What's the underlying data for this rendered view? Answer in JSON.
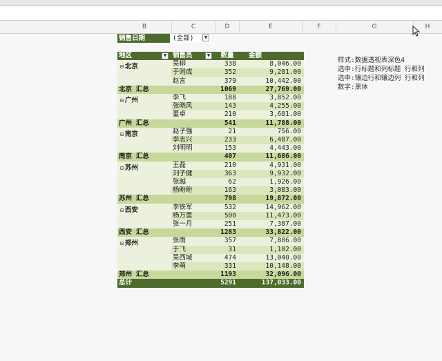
{
  "columns": [
    "B",
    "C",
    "D",
    "E",
    "F",
    "G",
    "H"
  ],
  "filter": {
    "label": "销售日期",
    "value": "(全部)"
  },
  "table": {
    "headers": {
      "region": "地区",
      "salesperson": "销售员",
      "qty": "数量",
      "amount": "金额"
    },
    "groups": [
      {
        "region": "北京",
        "rows": [
          {
            "name": "吴柳",
            "qty": "338",
            "amount": "8,046.00"
          },
          {
            "name": "于则成",
            "qty": "352",
            "amount": "9,281.00"
          },
          {
            "name": "赵言",
            "qty": "379",
            "amount": "10,442.00"
          }
        ],
        "subtotal": {
          "label": "北京 汇总",
          "qty": "1069",
          "amount": "27,769.00"
        }
      },
      {
        "region": "广州",
        "rows": [
          {
            "name": "李飞",
            "qty": "188",
            "amount": "3,852.00"
          },
          {
            "name": "张晓风",
            "qty": "143",
            "amount": "4,255.00"
          },
          {
            "name": "董卓",
            "qty": "210",
            "amount": "3,681.00"
          }
        ],
        "subtotal": {
          "label": "广州 汇总",
          "qty": "541",
          "amount": "11,788.00"
        }
      },
      {
        "region": "南京",
        "rows": [
          {
            "name": "赵子强",
            "qty": "21",
            "amount": "756.00"
          },
          {
            "name": "李志兴",
            "qty": "233",
            "amount": "6,487.00"
          },
          {
            "name": "刘明明",
            "qty": "153",
            "amount": "4,443.00"
          }
        ],
        "subtotal": {
          "label": "南京 汇总",
          "qty": "407",
          "amount": "11,686.00"
        }
      },
      {
        "region": "苏州",
        "rows": [
          {
            "name": "王磊",
            "qty": "210",
            "amount": "4,931.00"
          },
          {
            "name": "刘子健",
            "qty": "363",
            "amount": "9,932.00"
          },
          {
            "name": "张越",
            "qty": "62",
            "amount": "1,926.00"
          },
          {
            "name": "杨盼盼",
            "qty": "163",
            "amount": "3,083.00"
          }
        ],
        "subtotal": {
          "label": "苏州 汇总",
          "qty": "798",
          "amount": "19,872.00"
        }
      },
      {
        "region": "西安",
        "rows": [
          {
            "name": "李铁军",
            "qty": "532",
            "amount": "14,962.00"
          },
          {
            "name": "杨万里",
            "qty": "500",
            "amount": "11,473.00"
          },
          {
            "name": "张一月",
            "qty": "251",
            "amount": "7,387.00"
          }
        ],
        "subtotal": {
          "label": "西安 汇总",
          "qty": "1283",
          "amount": "33,822.00"
        }
      },
      {
        "region": "郑州",
        "rows": [
          {
            "name": "张雨",
            "qty": "357",
            "amount": "7,806.00"
          },
          {
            "name": "于飞",
            "qty": "31",
            "amount": "1,102.00"
          },
          {
            "name": "吴西城",
            "qty": "474",
            "amount": "13,040.00"
          },
          {
            "name": "李萌",
            "qty": "331",
            "amount": "10,148.00"
          }
        ],
        "subtotal": {
          "label": "郑州 汇总",
          "qty": "1193",
          "amount": "32,096.00"
        }
      }
    ],
    "grand_total": {
      "label": "总计",
      "qty": "5291",
      "amount": "137,033.00"
    }
  },
  "notes": [
    "样式:数据透视表深色4",
    "选中:行标题和列标题   行和列",
    "选中:镶边行和镶边列   行和列",
    "数字:黑体"
  ],
  "colors": {
    "header": "#4d6b2c",
    "subtotal": "#c6d89a",
    "region": "#ebf1dc",
    "band": "#dbe6bc"
  }
}
